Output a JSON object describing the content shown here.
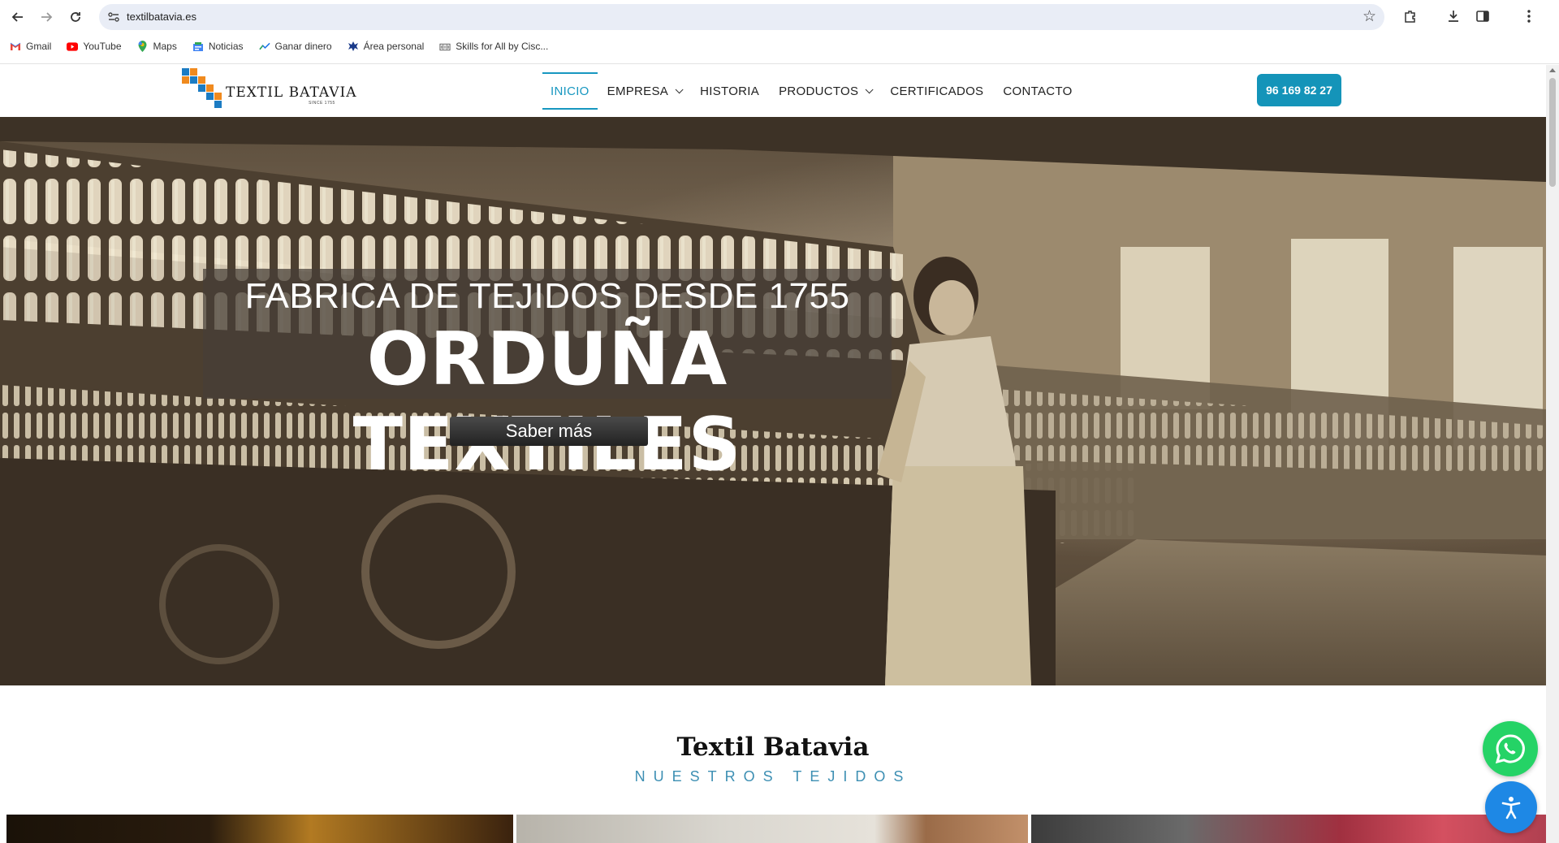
{
  "browser": {
    "url": "textilbatavia.es",
    "bookmarks": [
      {
        "label": "Gmail",
        "icon": "gmail-icon"
      },
      {
        "label": "YouTube",
        "icon": "youtube-icon"
      },
      {
        "label": "Maps",
        "icon": "maps-icon"
      },
      {
        "label": "Noticias",
        "icon": "news-icon"
      },
      {
        "label": "Ganar dinero",
        "icon": "money-icon"
      },
      {
        "label": "Área personal",
        "icon": "personal-area-icon"
      },
      {
        "label": "Skills for All by Cisc...",
        "icon": "cisco-icon"
      }
    ]
  },
  "site": {
    "logo": {
      "text": "TEXTIL BATAVIA",
      "since": "SINCE 1755"
    },
    "menu": [
      "INICIO",
      "EMPRESA",
      "HISTORIA",
      "PRODUCTOS",
      "CERTIFICADOS",
      "CONTACTO"
    ],
    "phone": "96 169 82 27"
  },
  "hero": {
    "subtitle": "FABRICA DE TEJIDOS DESDE 1755",
    "title": "ORDUÑA TEXTILES",
    "button": "Saber más"
  },
  "section": {
    "title": "Textil Batavia",
    "subtitle": "NUESTROS TEJIDOS"
  },
  "colors": {
    "accent": "#1797c0",
    "phone_button": "#1494b9",
    "whatsapp": "#25d366",
    "accessibility": "#1e88e5"
  }
}
